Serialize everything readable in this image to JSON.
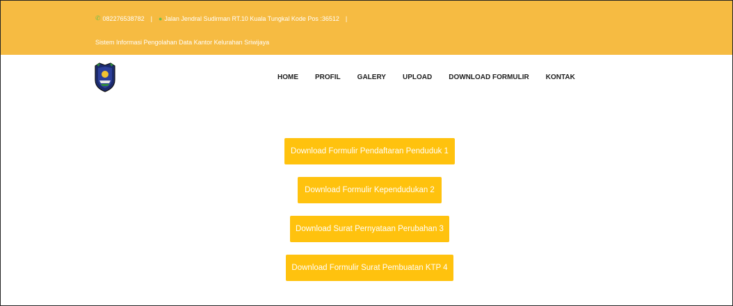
{
  "topbar": {
    "phone": "082276538782",
    "separator": "|",
    "address": "Jalan Jendral Sudirman RT.10 Kuala Tungkal Kode Pos :36512",
    "tagline": "Sistem Informasi Pengolahan Data Kantor Kelurahan Sriwijaya",
    "phone_icon": "phone-icon",
    "location_icon": "location-icon"
  },
  "nav": {
    "items": [
      "HOME",
      "PROFIL",
      "GALERY",
      "UPLOAD",
      "DOWNLOAD FORMULIR",
      "KONTAK"
    ]
  },
  "downloads": {
    "items": [
      "Download Formulir Pendaftaran Penduduk 1",
      "Download Formulir Kependudukan 2",
      "Download Surat Pernyataan Perubahan 3",
      "Download Formulir Surat Pembuatan KTP 4"
    ]
  },
  "colors": {
    "topbar": "#f6bb42",
    "button": "#ffc20e",
    "icon": "#6fbf4a"
  }
}
